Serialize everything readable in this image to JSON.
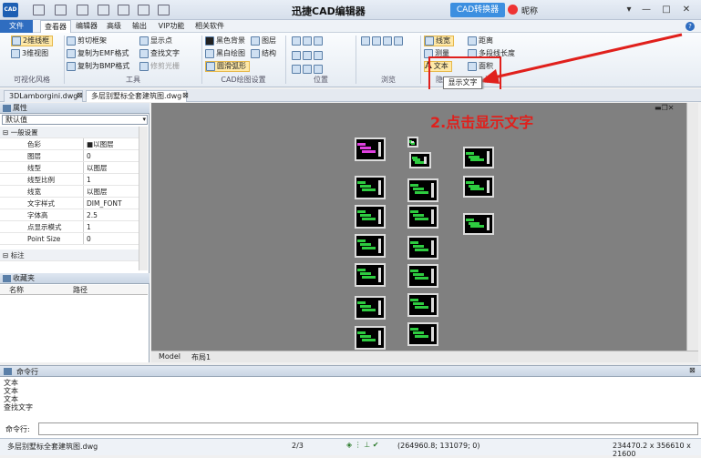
{
  "app": {
    "title": "迅捷CAD编辑器",
    "logo": "CAD",
    "convert": "CAD转换器",
    "user": "昵称"
  },
  "window_buttons": [
    "▾",
    "—",
    "□",
    "✕"
  ],
  "menu": [
    "文件",
    "查看器",
    "编辑器",
    "高级",
    "输出",
    "VIP功能",
    "相关软件"
  ],
  "ribbon": {
    "viewstyle": {
      "b1": "2维线框",
      "b2": "3维视图",
      "label": "可视化风格"
    },
    "tools": {
      "b1": "剪切框架",
      "b2": "复制为EMF格式",
      "b3": "复制为BMP格式",
      "b4": "显示点",
      "b5": "查找文字",
      "b6": "修剪光栅",
      "label": "工具"
    },
    "cadset": {
      "b1": "黑色背景",
      "b2": "黑白绘图",
      "b3": "圆滑弧形",
      "b4": "图层",
      "b5": "结构",
      "label": "CAD绘图设置"
    },
    "position": {
      "label": "位置"
    },
    "browse": {
      "label": "浏览"
    },
    "hide": {
      "b1": "线宽",
      "b2": "测量",
      "b3": "文本",
      "label": "隐"
    },
    "measure": {
      "b1": "距离",
      "b2": "多段线长度",
      "b3": "面积",
      "label": "测量"
    }
  },
  "tooltip": "显示文字",
  "annotation": "2.点击显示文字",
  "doc_tabs": [
    "3DLamborgini.dwg",
    "多层别墅标全套建筑图.dwg"
  ],
  "properties": {
    "title": "属性",
    "select": "默认值",
    "group1": "一般设置",
    "rows": [
      [
        "色彩",
        "■以图层"
      ],
      [
        "图层",
        "0"
      ],
      [
        "线型",
        "以图层"
      ],
      [
        "线型比例",
        "1"
      ],
      [
        "线宽",
        "以图层"
      ],
      [
        "文字样式",
        "DIM_FONT"
      ],
      [
        "字体高",
        "2.5"
      ],
      [
        "点显示模式",
        "1"
      ],
      [
        "Point Size",
        "0"
      ]
    ],
    "group2": "标注"
  },
  "favorites": {
    "title": "收藏夹",
    "col1": "名称",
    "col2": "路径"
  },
  "layout_tabs": [
    "Model",
    "布局1"
  ],
  "command": {
    "title": "命令行",
    "lines": [
      "文本",
      "文本",
      "文本",
      "查找文字"
    ],
    "prompt": "命令行:"
  },
  "status": {
    "file": "多层别墅标全套建筑图.dwg",
    "page": "2/3",
    "coords": "(264960.8; 131079; 0)",
    "size": "234470.2 x 356610 x 21600"
  }
}
